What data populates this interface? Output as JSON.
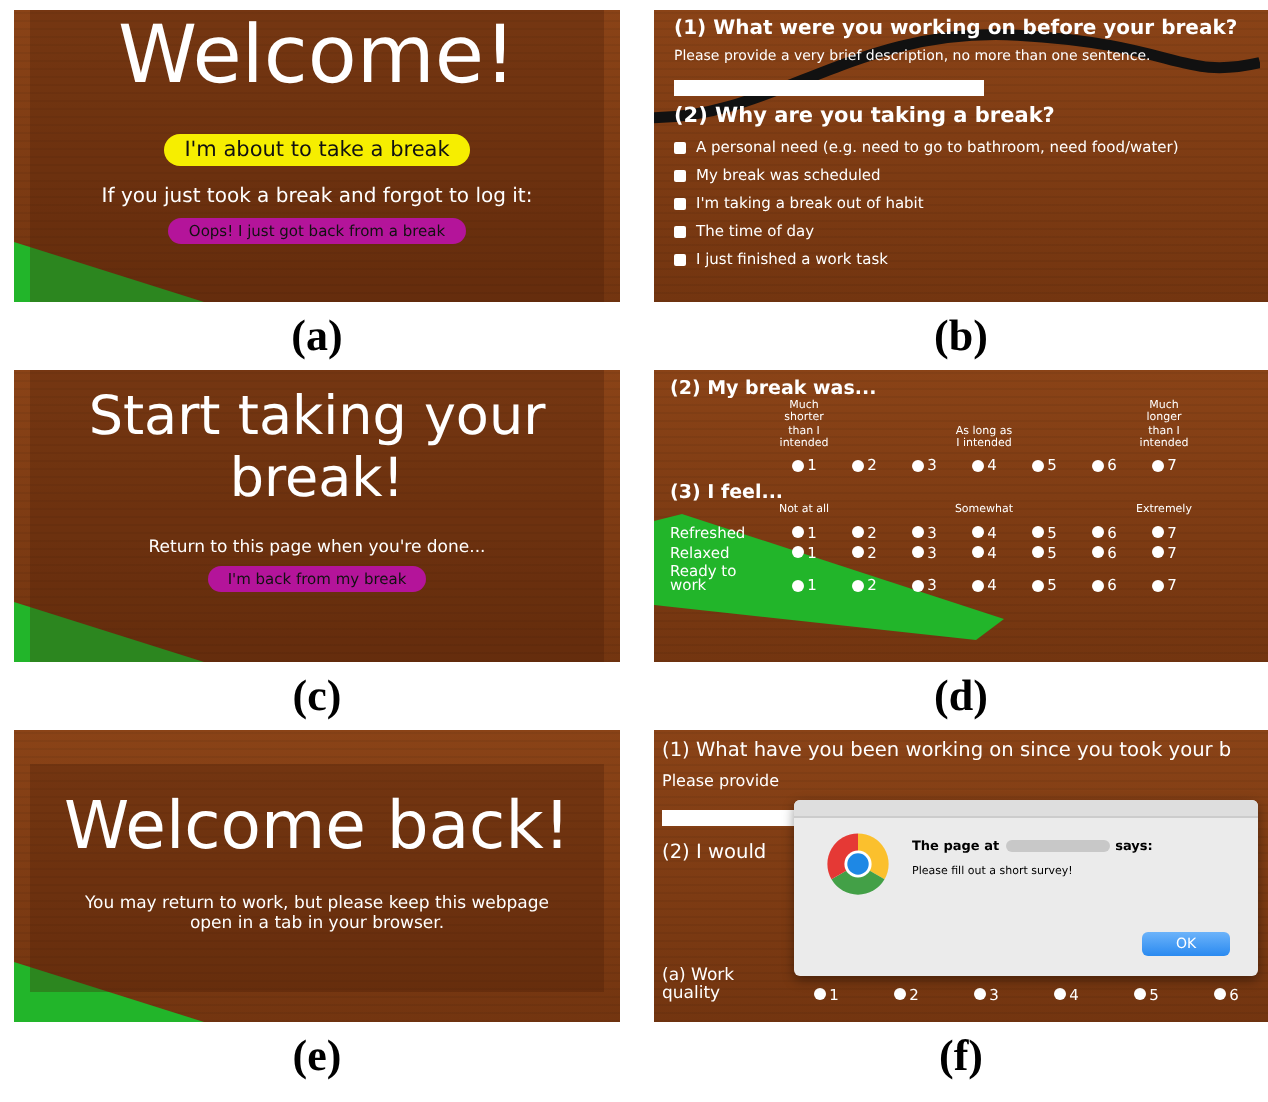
{
  "panels": [
    {
      "kind": "landing",
      "caption": "(a)",
      "title": "Welcome!",
      "primary_button": "I'm about to take a break",
      "prompt": "If you just took a break and forgot to log it:",
      "secondary_button": "Oops! I just got back from a break"
    },
    {
      "kind": "reasons",
      "caption": "(b)",
      "question_1": "(1) What were you working on before your break?",
      "hint": "Please provide a very brief description, no more than one sentence.",
      "question_2": "(2) Why are you taking a break?",
      "options": [
        {
          "label": "A personal need (e.g. need to go to bathroom, need food/water)",
          "checked": false
        },
        {
          "label": "My break was scheduled",
          "checked": false
        },
        {
          "label": "I'm taking a break out of habit",
          "checked": false
        },
        {
          "label": "The time of day",
          "checked": false
        },
        {
          "label": "I just finished a work task",
          "checked": false
        }
      ]
    },
    {
      "kind": "on_break",
      "caption": "(c)",
      "title": "Start taking your break!",
      "prompt": "Return to this page when you're done...",
      "button": "I'm back from my break"
    },
    {
      "kind": "ratings",
      "caption": "(d)",
      "questions": [
        {
          "title": "(2) My break was...",
          "rows": [
            {
              "options": [
                {
                  "label": "1",
                  "selected": false,
                  "anchor": "Much shorter than I intended"
                },
                {
                  "label": "2",
                  "selected": false
                },
                {
                  "label": "3",
                  "selected": false
                },
                {
                  "label": "4",
                  "selected": false,
                  "anchor": "As long as I intended"
                },
                {
                  "label": "5",
                  "selected": false
                },
                {
                  "label": "6",
                  "selected": false
                },
                {
                  "label": "7",
                  "selected": false,
                  "anchor": "Much longer than I intended"
                }
              ]
            }
          ]
        },
        {
          "title": "(3) I feel...",
          "rows": [
            {
              "label": "Refreshed",
              "options": [
                {
                  "label": "1",
                  "selected": false,
                  "anchor": "Not at all"
                },
                {
                  "label": "2",
                  "selected": false
                },
                {
                  "label": "3",
                  "selected": false
                },
                {
                  "label": "4",
                  "selected": false,
                  "anchor": "Somewhat"
                },
                {
                  "label": "5",
                  "selected": false
                },
                {
                  "label": "6",
                  "selected": false
                },
                {
                  "label": "7",
                  "selected": false,
                  "anchor": "Extremely"
                }
              ]
            },
            {
              "label": "Relaxed",
              "options": [
                {
                  "label": "1",
                  "selected": false
                },
                {
                  "label": "2",
                  "selected": false
                },
                {
                  "label": "3",
                  "selected": false
                },
                {
                  "label": "4",
                  "selected": false
                },
                {
                  "label": "5",
                  "selected": false
                },
                {
                  "label": "6",
                  "selected": false
                },
                {
                  "label": "7",
                  "selected": false
                }
              ]
            },
            {
              "label": "Ready to work",
              "options": [
                {
                  "label": "1",
                  "selected": false
                },
                {
                  "label": "2",
                  "selected": false
                },
                {
                  "label": "3",
                  "selected": false
                },
                {
                  "label": "4",
                  "selected": false
                },
                {
                  "label": "5",
                  "selected": false
                },
                {
                  "label": "6",
                  "selected": false
                },
                {
                  "label": "7",
                  "selected": false
                }
              ]
            }
          ]
        }
      ]
    },
    {
      "kind": "welcome_back",
      "caption": "(e)",
      "title": "Welcome back!",
      "message": "You may return to work, but please keep this webpage open in a tab in your browser."
    },
    {
      "kind": "alert",
      "caption": "(f)",
      "question_1": "(1) What have you been working on since you took your b",
      "hint": "Please provide",
      "question_2": "(2) I would",
      "rows": [
        {
          "label": "(a) Work quality",
          "options": [
            {
              "label": "1",
              "selected": false
            },
            {
              "label": "2",
              "selected": false
            },
            {
              "label": "3",
              "selected": false
            },
            {
              "label": "4",
              "selected": false
            },
            {
              "label": "5",
              "selected": false
            },
            {
              "label": "6",
              "selected": false
            }
          ]
        }
      ],
      "dialog": {
        "title_start": "The page at",
        "title_end": "says:",
        "message": "Please fill out a short survey!",
        "button": "OK"
      }
    }
  ]
}
